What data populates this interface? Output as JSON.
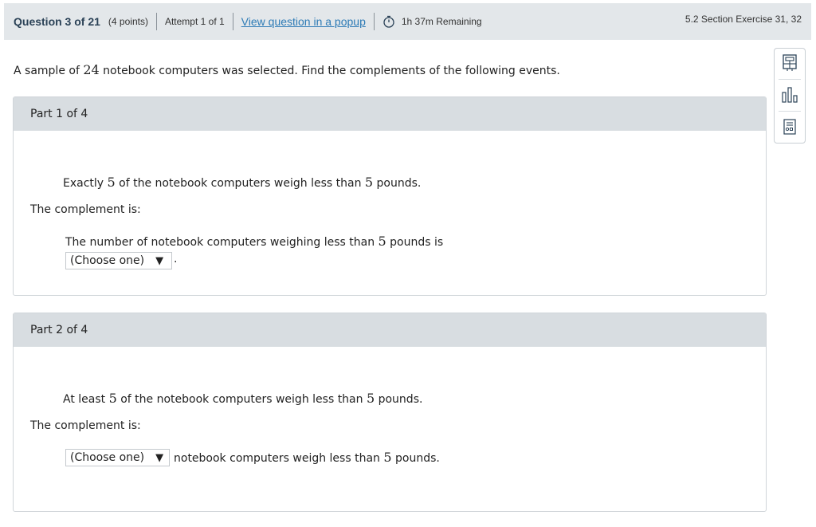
{
  "header": {
    "question": "Question 3 of 21",
    "points": "(4 points)",
    "attempt": "Attempt 1 of 1",
    "popup_link": "View question in a popup",
    "remaining": "1h 37m Remaining",
    "section": "5.2 Section Exercise 31, 32"
  },
  "prompt": {
    "before": "A sample of",
    "number": "24",
    "after": "notebook computers was selected. Find the complements of the following events."
  },
  "parts": [
    {
      "title": "Part 1 of 4",
      "event_before": "Exactly",
      "event_n1": "5",
      "event_mid": "of the notebook computers weigh less than",
      "event_n2": "5",
      "event_after": "pounds.",
      "complement_label": "The complement is:",
      "answer_before": "The number of notebook computers weighing less than",
      "answer_n": "5",
      "answer_after": "pounds is",
      "select_value": "(Choose one)",
      "select_arrow": "▼",
      "trailing": "."
    },
    {
      "title": "Part 2 of 4",
      "event_before": "At least",
      "event_n1": "5",
      "event_mid": "of the notebook computers weigh less than",
      "event_n2": "5",
      "event_after": "pounds.",
      "complement_label": "The complement is:",
      "select_value": "(Choose one)",
      "select_arrow": "▼",
      "answer_after_select": "notebook computers weigh less than",
      "answer_n": "5",
      "answer_after": "pounds."
    }
  ],
  "tools": [
    "calculator-icon",
    "bar-chart-icon",
    "data-table-icon"
  ],
  "colors": {
    "header_bg": "#e3e7ea",
    "part_header_bg": "#d8dde1",
    "link": "#2e7bb6",
    "title_text": "#2b4257"
  }
}
